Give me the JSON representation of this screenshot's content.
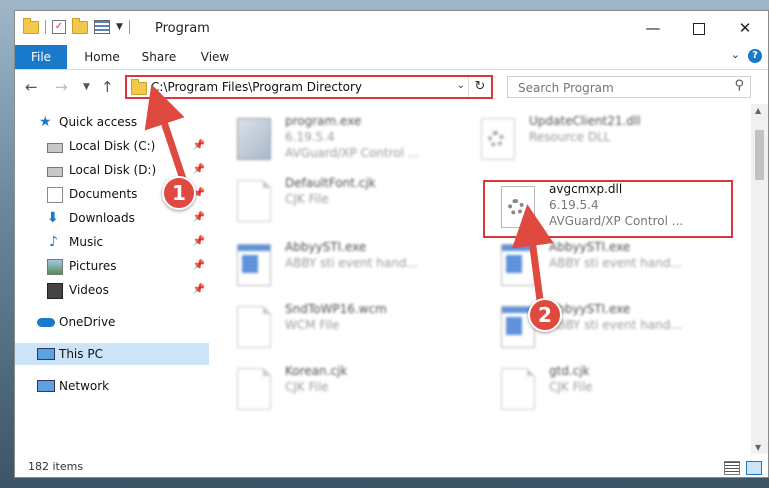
{
  "window": {
    "title": "Program",
    "minimize_glyph": "—",
    "close_glyph": "✕"
  },
  "ribbon": {
    "tabs": [
      "File",
      "Home",
      "Share",
      "View"
    ],
    "help_glyph": "?"
  },
  "address": {
    "path": "C:\\Program Files\\Program Directory",
    "search_placeholder": "Search Program"
  },
  "sidebar": {
    "items": [
      {
        "label": "Quick access",
        "icon": "star-icon",
        "pinned": false
      },
      {
        "label": "Local Disk (C:)",
        "icon": "drive-icon",
        "pinned": true
      },
      {
        "label": "Local Disk (D:)",
        "icon": "drive-icon",
        "pinned": true
      },
      {
        "label": "Documents",
        "icon": "documents-icon",
        "pinned": true
      },
      {
        "label": "Downloads",
        "icon": "download-icon",
        "pinned": true
      },
      {
        "label": "Music",
        "icon": "music-icon",
        "pinned": true
      },
      {
        "label": "Pictures",
        "icon": "pictures-icon",
        "pinned": true
      },
      {
        "label": "Videos",
        "icon": "videos-icon",
        "pinned": true
      },
      {
        "label": "OneDrive",
        "icon": "cloud-icon",
        "pinned": false
      },
      {
        "label": "This PC",
        "icon": "computer-icon",
        "pinned": false,
        "selected": true
      },
      {
        "label": "Network",
        "icon": "network-icon",
        "pinned": false
      }
    ]
  },
  "files": [
    {
      "name": "program.exe",
      "line2": "6.19.5.4",
      "line3": "AVGuard/XP Control ...",
      "icon": "exe-icon",
      "blurred": true
    },
    {
      "name": "UpdateClient21.dll",
      "line2": "Resource DLL",
      "line3": "",
      "icon": "dll-icon",
      "blurred": true
    },
    {
      "name": "DefaultFont.cjk",
      "line2": "CJK File",
      "line3": "",
      "icon": "file-icon",
      "blurred": true
    },
    {
      "name": "avgcmxp.dll",
      "line2": "6.19.5.4",
      "line3": "AVGuard/XP Control ...",
      "icon": "dll-gear-icon",
      "blurred": false,
      "highlighted": true
    },
    {
      "name": "AbbyySTI.exe",
      "line2": "ABBY sti event hand...",
      "line3": "",
      "icon": "app-icon",
      "blurred": true
    },
    {
      "name": "AbbyySTI.exe",
      "line2": "ABBY sti event hand...",
      "line3": "",
      "icon": "app-icon",
      "blurred": true
    },
    {
      "name": "SndToWP16.wcm",
      "line2": "WCM File",
      "line3": "",
      "icon": "file-icon",
      "blurred": true
    },
    {
      "name": "AbbyySTI.exe",
      "line2": "ABBY sti event hand...",
      "line3": "",
      "icon": "app-icon",
      "blurred": true
    },
    {
      "name": "Korean.cjk",
      "line2": "CJK File",
      "line3": "",
      "icon": "file-icon",
      "blurred": true
    },
    {
      "name": "gtd.cjk",
      "line2": "CJK File",
      "line3": "",
      "icon": "file-icon",
      "blurred": true
    }
  ],
  "status": {
    "item_count": "182 items"
  },
  "annotations": {
    "step1": "1",
    "step2": "2",
    "color": "#e0493f"
  },
  "colors": {
    "accent": "#1979ca",
    "highlight": "#d9363e",
    "selection": "#cce4f7"
  }
}
